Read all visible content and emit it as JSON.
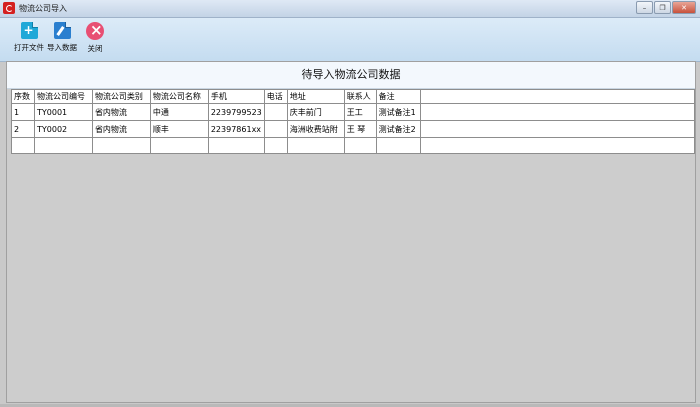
{
  "window": {
    "title": "物流公司导入"
  },
  "toolbar": {
    "open_label": "打开文件",
    "import_label": "导入数据",
    "close_label": "关闭"
  },
  "grid": {
    "title": "待导入物流公司数据",
    "columns": [
      "序数",
      "物流公司编号",
      "物流公司类别",
      "物流公司名称",
      "手机",
      "电话",
      "地址",
      "联系人",
      "备注"
    ],
    "rows": [
      [
        "1",
        "TY0001",
        "省内物流",
        "中通",
        "2239799523",
        "",
        "庆丰前门",
        "王工",
        "测试备注1"
      ],
      [
        "2",
        "TY0002",
        "省内物流",
        "顺丰",
        "22397861xx",
        "",
        "海洲收费站附",
        "王 琴",
        "测试备注2"
      ]
    ]
  }
}
